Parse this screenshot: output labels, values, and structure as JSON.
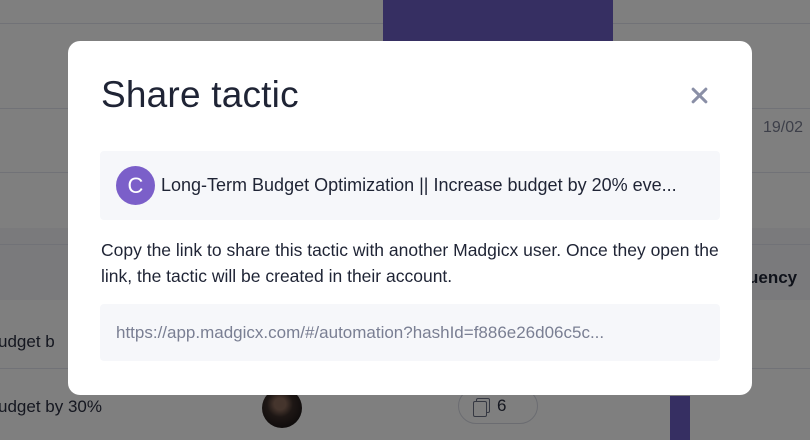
{
  "background": {
    "date_fragment": "19/02",
    "column_header_fragment": "uency",
    "row1_text": "udget b",
    "row2_text": "udget by 30%",
    "count_badge": "6",
    "accent_color": "#6d5fc4"
  },
  "modal": {
    "title": "Share tactic",
    "tactic": {
      "avatar_letter": "C",
      "name": "Long-Term Budget Optimization || Increase budget by 20% eve..."
    },
    "description": "Copy the link to share this tactic with another Madgicx user. Once they open the link, the tactic will be created in their account.",
    "share_link": "https://app.madgicx.com/#/automation?hashId=f886e26d06c5c..."
  }
}
